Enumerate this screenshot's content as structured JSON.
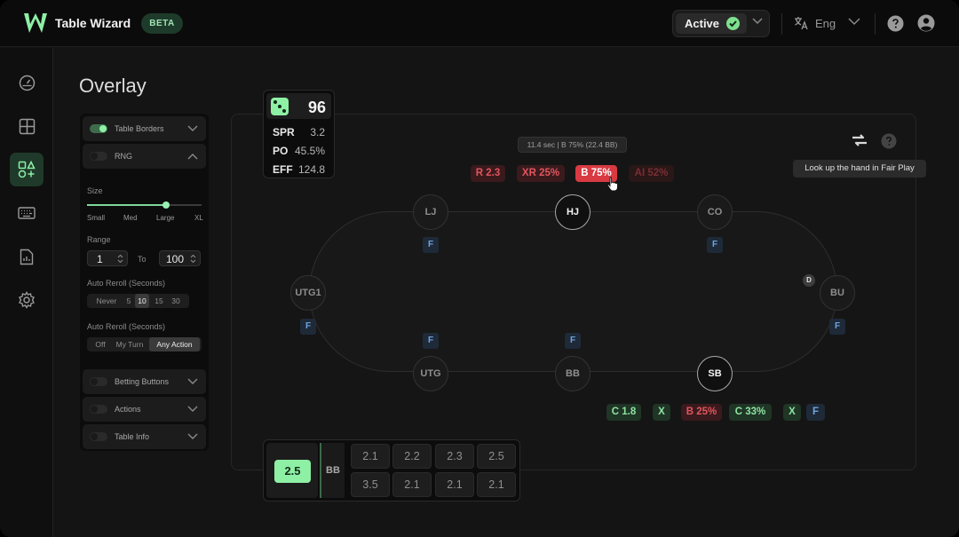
{
  "app": {
    "title": "Table Wizard",
    "badge": "BETA"
  },
  "header": {
    "status_label": "Active",
    "language": "Eng"
  },
  "page": {
    "title": "Overlay"
  },
  "settings": {
    "table_borders": "Table Borders",
    "rng": "RNG",
    "size_label": "Size",
    "size_ticks": [
      "Small",
      "Med",
      "Large",
      "XL"
    ],
    "size_value": "Large",
    "range_label": "Range",
    "range_from": "1",
    "range_to_label": "To",
    "range_to": "100",
    "auto_reroll_label": "Auto Reroll (Seconds)",
    "auto_reroll_options": [
      "Never",
      "5",
      "10",
      "15",
      "30"
    ],
    "auto_reroll_selected": "10",
    "auto_reroll2_label": "Auto Reroll (Seconds)",
    "auto_reroll2_options": [
      "Off",
      "My Turn",
      "Any Action"
    ],
    "auto_reroll2_selected": "Any Action",
    "betting_buttons": "Betting Buttons",
    "actions": "Actions",
    "table_info": "Table Info"
  },
  "rng_card": {
    "value": "96",
    "stats": [
      {
        "k": "SPR",
        "v": "3.2"
      },
      {
        "k": "PO",
        "v": "45.5%"
      },
      {
        "k": "EFF",
        "v": "124.8"
      }
    ]
  },
  "table": {
    "info": "11.4 sec | B 75% (22.4 BB)",
    "tooltip": "Look up the hand in Fair Play",
    "dealer": "D",
    "top_actions": [
      "R 2.3",
      "XR 25%",
      "B 75%",
      "AI 52%"
    ],
    "seats": [
      "LJ",
      "HJ",
      "CO",
      "UTG1",
      "BU",
      "UTG",
      "BB",
      "SB"
    ],
    "fold": "F",
    "bottom_actions": [
      "C 1.8",
      "X",
      "B 25%",
      "C 33%",
      "X",
      "F"
    ]
  },
  "betting": {
    "selected": "2.5",
    "unit": "BB",
    "row1": [
      "2.1",
      "2.2",
      "2.3",
      "2.5"
    ],
    "row2": [
      "3.5",
      "2.1",
      "2.1",
      "2.1"
    ]
  },
  "colors": {
    "accent": "#8ef0a5",
    "raise": "#d93a42",
    "fold": "#6fa3e0"
  },
  "icons": [
    "logo-icon",
    "check-circle-icon",
    "translate-icon",
    "help-icon",
    "user-icon",
    "dashboard-icon",
    "grid-icon",
    "shapes-icon",
    "keyboard-icon",
    "report-icon",
    "gear-icon",
    "swap-icon",
    "dice-icon",
    "cursor-icon"
  ]
}
